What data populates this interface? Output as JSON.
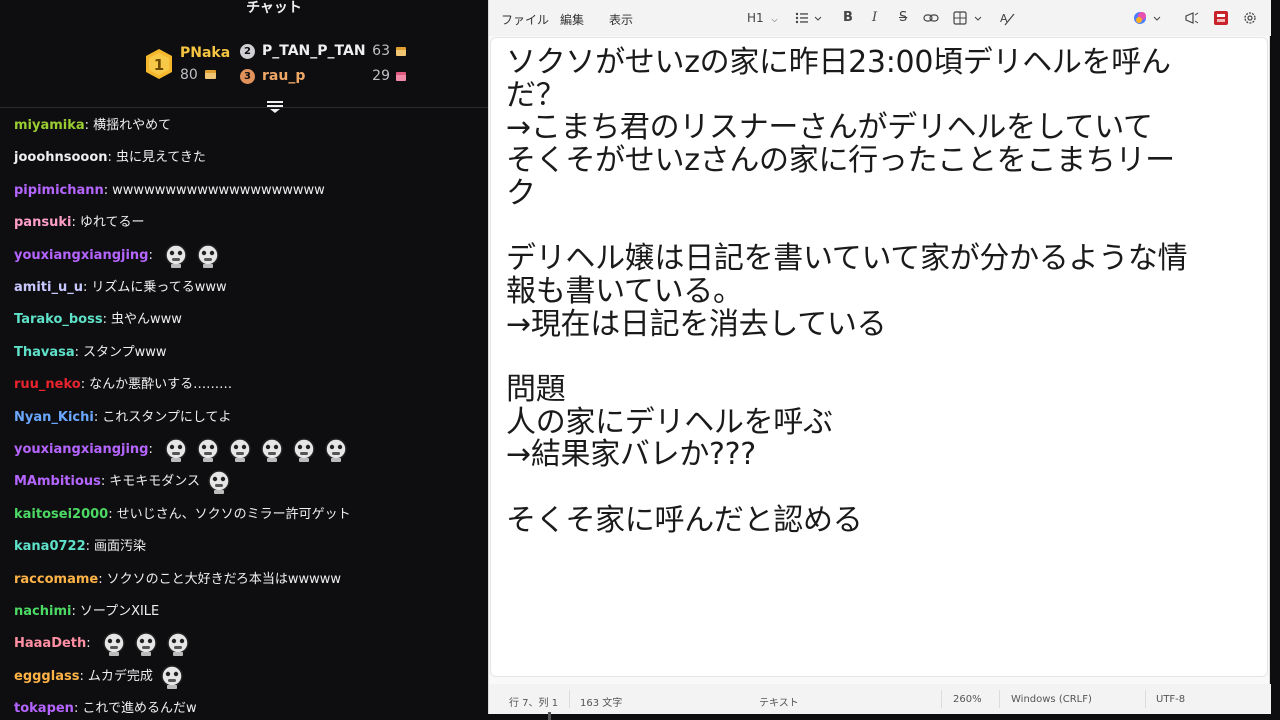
{
  "chat": {
    "title": "チャット",
    "leaderboard": {
      "first": {
        "name": "PNaka",
        "score": "80",
        "rank": "1"
      },
      "second": {
        "name": "P_TAN_P_TAN",
        "score": "63",
        "rank": "2"
      },
      "third": {
        "name": "rau_p",
        "score": "29",
        "rank": "3"
      }
    },
    "messages": [
      {
        "user": "miyamika",
        "color": "#9acd32",
        "text": "横揺れやめて",
        "emotes": 0
      },
      {
        "user": "jooohnsooon",
        "color": "#efeff1",
        "text": "虫に見えてきた",
        "emotes": 0
      },
      {
        "user": "pipimichann",
        "color": "#b565ff",
        "text": "wwwwwwwwwwwwwwwwwwww",
        "emotes": 0
      },
      {
        "user": "pansuki",
        "color": "#ff9ec8",
        "text": "ゆれてるー",
        "emotes": 0
      },
      {
        "user": "youxiangxiangjing",
        "color": "#b565ff",
        "text": "",
        "emotes": 2
      },
      {
        "user": "amiti_u_u",
        "color": "#c8c8ff",
        "text": "リズムに乗ってるwww",
        "emotes": 0
      },
      {
        "user": "Tarako_boss",
        "color": "#5fe0c8",
        "text": "虫やんwww",
        "emotes": 0
      },
      {
        "user": "Thavasa",
        "color": "#5fe0c8",
        "text": "スタンプwww",
        "emotes": 0
      },
      {
        "user": "ruu_neko",
        "color": "#e8242e",
        "text": "なんか悪酔いする………",
        "emotes": 0
      },
      {
        "user": "Nyan_Kichi",
        "color": "#6aa8ff",
        "text": "これスタンプにしてよ",
        "emotes": 0
      },
      {
        "user": "youxiangxiangjing",
        "color": "#b565ff",
        "text": "",
        "emotes": 6
      },
      {
        "user": "MAmbitious",
        "color": "#b565ff",
        "text": "キモキモダンス",
        "emotes": 1
      },
      {
        "user": "kaitosei2000",
        "color": "#4cd964",
        "text": "せいじさん、ソクソのミラー許可ゲット",
        "emotes": 0
      },
      {
        "user": "kana0722",
        "color": "#5fe0c8",
        "text": "画面汚染",
        "emotes": 0
      },
      {
        "user": "raccomame",
        "color": "#ffb347",
        "text": "ソクソのこと大好きだろ本当はwwwww",
        "emotes": 0
      },
      {
        "user": "nachimi",
        "color": "#4cd964",
        "text": "ソープンXILE",
        "emotes": 0
      },
      {
        "user": "HaaaDeth",
        "color": "#ff8fa3",
        "text": "",
        "emotes": 3
      },
      {
        "user": "eggglass",
        "color": "#ffb347",
        "text": "ムカデ完成",
        "emotes": 1
      },
      {
        "user": "tokapen",
        "color": "#b565ff",
        "text": "これで進めるんだw",
        "emotes": 0
      }
    ]
  },
  "notepad": {
    "menu": [
      "ファイル",
      "編集",
      "表示"
    ],
    "heading_label": "H1",
    "content": "ソクソがせいzの家に昨日23:00頃デリヘルを呼ん\nだ？\n→こまち君のリスナーさんがデリヘルをしていて\nそくそがせいzさんの家に行ったことをこまちリー\nク\n\nデリヘル嬢は日記を書いていて家が分かるような情\n報も書いている。\n→現在は日記を消去している\n\n問題\n人の家にデリヘルを呼ぶ\n→結果家バレか???\n\nそくそ家に呼んだと認める",
    "status": {
      "position": "行 7、列 1",
      "chars": "163 文字",
      "mode": "テキスト",
      "zoom": "260%",
      "line_ending": "Windows (CRLF)",
      "encoding": "UTF-8"
    }
  }
}
